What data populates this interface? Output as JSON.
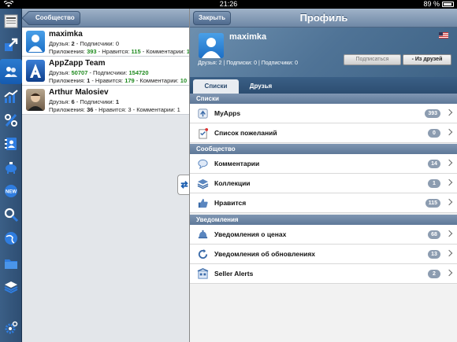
{
  "statusbar": {
    "time": "21:26",
    "battery": "89 %"
  },
  "dock": {
    "icons": [
      "news-icon",
      "share-icon",
      "social-icon",
      "chart-icon",
      "percent-icon",
      "contacts-icon",
      "piggybank-icon",
      "new-icon",
      "search-icon",
      "globe-icon",
      "folder-icon",
      "stack-icon",
      "settings-icon"
    ]
  },
  "left": {
    "back_label": "Сообщество",
    "users": [
      {
        "name": "maximka",
        "friends_label": "Друзья:",
        "friends": "2",
        "followers_label": "- Подписчики:",
        "followers": "0",
        "apps_label": "Приложения:",
        "apps": "393",
        "likes_label": "- Нравится:",
        "likes": "115",
        "comments_label": "- Комментарии:",
        "comments": "14"
      },
      {
        "name": "AppZapp Team",
        "friends_label": "Друзья:",
        "friends": "50707",
        "followers_label": "- Подписчики:",
        "followers": "154720",
        "apps_label": "Приложения:",
        "apps": "1",
        "likes_label": "- Нравится:",
        "likes": "179",
        "comments_label": "- Комментарии:",
        "comments": "10"
      },
      {
        "name": "Arthur Malosiev",
        "friends_label": "Друзья:",
        "friends": "6",
        "followers_label": "- Подписчики:",
        "followers": "1",
        "apps_label": "Приложения:",
        "apps": "36",
        "likes_label": "- Нравится: 3",
        "likes": "",
        "comments_label": "- Комментарии: 1",
        "comments": ""
      }
    ]
  },
  "right": {
    "close_label": "Закрыть",
    "title": "Профиль",
    "profile": {
      "name": "maximka",
      "stats": "Друзья: 2 | Подписки: 0 | Подписчики: 0",
      "follow_label": "Подписаться",
      "unfriend_label": "- Из друзей"
    },
    "tabs": [
      "Списки",
      "Друзья"
    ],
    "sections": [
      {
        "title": "Списки",
        "rows": [
          {
            "label": "MyApps",
            "badge": "393",
            "icon": "apps-icon"
          },
          {
            "label": "Список пожеланий",
            "badge": "0",
            "icon": "wishlist-icon"
          }
        ]
      },
      {
        "title": "Сообщество",
        "rows": [
          {
            "label": "Комментарии",
            "badge": "14",
            "icon": "comments-icon"
          },
          {
            "label": "Коллекции",
            "badge": "1",
            "icon": "collections-icon"
          },
          {
            "label": "Нравится",
            "badge": "115",
            "icon": "like-icon"
          }
        ]
      },
      {
        "title": "Уведомления",
        "rows": [
          {
            "label": "Уведомления о ценах",
            "badge": "68",
            "icon": "price-alert-icon"
          },
          {
            "label": "Уведомления об обновлениях",
            "badge": "13",
            "icon": "update-alert-icon"
          },
          {
            "label": "Seller Alerts",
            "badge": "2",
            "icon": "seller-alert-icon"
          }
        ]
      }
    ]
  },
  "colors": {
    "accent": "#2a7bd0",
    "badge": "#8c9cb0",
    "green": "#1e8a1e"
  }
}
